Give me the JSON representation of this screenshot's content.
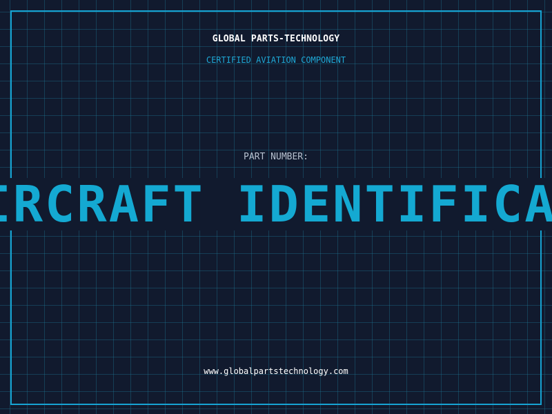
{
  "header": {
    "company_name": "GLOBAL PARTS-TECHNOLOGY",
    "subtitle": "CERTIFIED AVIATION COMPONENT"
  },
  "main": {
    "part_number_label": "PART NUMBER:",
    "banner_text": "AIRCRAFT IDENTIFICATION"
  },
  "footer": {
    "website": "www.globalpartstechnology.com"
  },
  "colors": {
    "background": "#111a2e",
    "grid": "#1e7896",
    "accent": "#16a3d2",
    "text_primary": "#ffffff",
    "text_muted": "#b8c2d0"
  }
}
